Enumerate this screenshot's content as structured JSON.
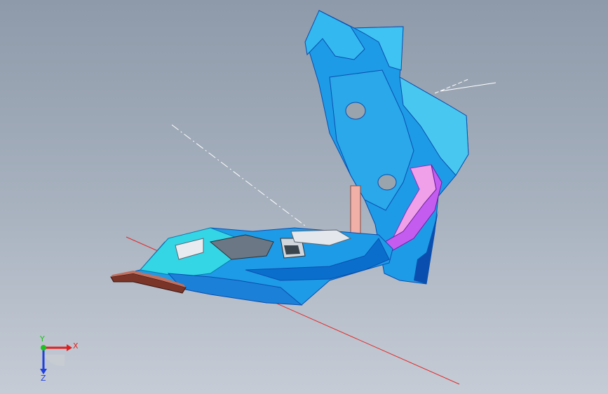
{
  "viewport": {
    "background_top": "#8e9aaa",
    "background_bottom": "#c6ccd6",
    "model_colors": {
      "primary_blue": "#1e9be6",
      "light_cyan": "#34d6e6",
      "dark_blue": "#0a4fb0",
      "magenta": "#c45cf0",
      "pink": "#f0a0e8",
      "brown": "#7a3428",
      "gray": "#9aa4ad"
    }
  },
  "triad": {
    "x_label": "X",
    "y_label": "Y",
    "z_label": "Z",
    "x_color": "#e02020",
    "y_color": "#20c020",
    "z_color": "#2040e0"
  }
}
